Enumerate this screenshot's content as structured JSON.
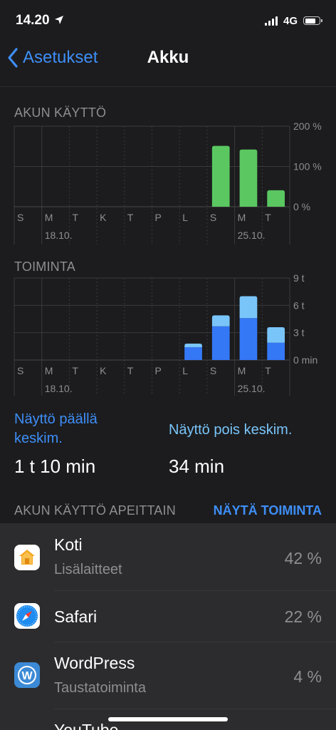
{
  "status_bar": {
    "time": "14.20",
    "network": "4G",
    "battery_level": 0.8
  },
  "nav": {
    "back_label": "Asetukset",
    "title": "Akku"
  },
  "battery_chart": {
    "section_label": "AKUN KÄYTTÖ",
    "y_ticks": [
      "200 %",
      "100 %",
      "0 %"
    ],
    "days": [
      "S",
      "M",
      "T",
      "K",
      "T",
      "P",
      "L",
      "S",
      "M",
      "T"
    ],
    "date_labels": [
      {
        "day_index": 1,
        "text": "18.10."
      },
      {
        "day_index": 8,
        "text": "25.10."
      }
    ],
    "color": "#5ac761"
  },
  "activity_chart": {
    "section_label": "TOIMINTA",
    "y_ticks": [
      "9 t",
      "6 t",
      "3 t",
      "0 min"
    ],
    "days": [
      "S",
      "M",
      "T",
      "K",
      "T",
      "P",
      "L",
      "S",
      "M",
      "T"
    ],
    "date_labels": [
      {
        "day_index": 1,
        "text": "18.10."
      },
      {
        "day_index": 8,
        "text": "25.10."
      }
    ],
    "color_on": "#3478f6",
    "color_off": "#79c5fa"
  },
  "chart_data": [
    {
      "type": "bar",
      "categories": [
        "S",
        "M",
        "T",
        "K",
        "T",
        "P",
        "L",
        "S",
        "M",
        "T"
      ],
      "values": [
        0,
        0,
        0,
        0,
        0,
        0,
        0,
        151,
        142,
        41
      ],
      "ylim": [
        0,
        200
      ]
    },
    {
      "type": "bar",
      "stacked": true,
      "categories": [
        "S",
        "M",
        "T",
        "K",
        "T",
        "P",
        "L",
        "S",
        "M",
        "T"
      ],
      "series": [
        {
          "values": [
            0,
            0,
            0,
            0,
            0,
            0,
            1.4,
            3.7,
            4.6,
            1.9
          ]
        },
        {
          "values": [
            0,
            0,
            0,
            0,
            0,
            0,
            0.4,
            1.2,
            2.4,
            1.7
          ]
        }
      ],
      "ylim": [
        0,
        9
      ]
    }
  ],
  "stats": {
    "on_label": "Näyttö päällä keskim.",
    "on_value": "1 t 10 min",
    "off_label": "Näyttö pois keskim.",
    "off_value": "34 min"
  },
  "apps": {
    "header": "AKUN KÄYTTÖ APEITTAIN",
    "toggle_label": "NÄYTÄ TOIMINTA",
    "items": [
      {
        "name": "Koti",
        "subtitle": "Lisälaitteet",
        "percent": "42 %",
        "icon": "home-app-icon"
      },
      {
        "name": "Safari",
        "subtitle": "",
        "percent": "22 %",
        "icon": "safari-app-icon"
      },
      {
        "name": "WordPress",
        "subtitle": "Taustatoiminta",
        "percent": "4 %",
        "icon": "wordpress-app-icon"
      },
      {
        "name": "YouTube",
        "subtitle": "",
        "percent": "",
        "icon": "youtube-app-icon"
      }
    ]
  }
}
